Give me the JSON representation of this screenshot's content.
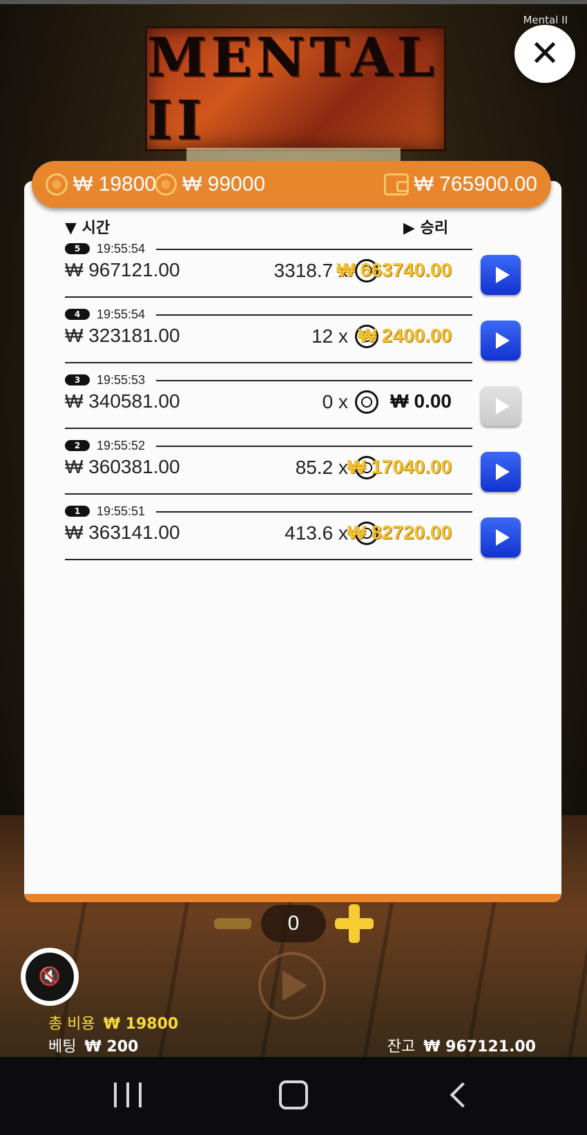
{
  "game_label": "Mental II",
  "logo_text": "MENTAL II",
  "header": {
    "coin_value_1": "₩ 19800",
    "coin_value_2": "₩ 99000",
    "wallet_value": "₩ 765900.00"
  },
  "columns": {
    "time_label": "▼ 시간",
    "win_label": "▶ 승리"
  },
  "rows": [
    {
      "badge": "5",
      "time": "19:55:54",
      "balance": "₩ 967121.00",
      "multiplier": "3318.7 x",
      "win": "₩ 663740.00",
      "replay_enabled": true
    },
    {
      "badge": "4",
      "time": "19:55:54",
      "balance": "₩ 323181.00",
      "multiplier": "12 x",
      "win": "₩ 2400.00",
      "replay_enabled": true
    },
    {
      "badge": "3",
      "time": "19:55:53",
      "balance": "₩ 340581.00",
      "multiplier": "0 x",
      "win": "₩ 0.00",
      "replay_enabled": false
    },
    {
      "badge": "2",
      "time": "19:55:52",
      "balance": "₩ 360381.00",
      "multiplier": "85.2 x",
      "win": "₩ 17040.00",
      "replay_enabled": true
    },
    {
      "badge": "1",
      "time": "19:55:51",
      "balance": "₩ 363141.00",
      "multiplier": "413.6 x",
      "win": "₩ 82720.00",
      "replay_enabled": true
    }
  ],
  "stepper": {
    "value": "0"
  },
  "footer": {
    "total_cost_label": "총 비용",
    "total_cost_value": "₩ 19800",
    "bet_label": "베팅",
    "bet_value": "₩ 200",
    "balance_label": "잔고",
    "balance_value": "₩ 967121.00"
  },
  "icons": {
    "close": "close-icon",
    "mute": "speaker-muted-icon",
    "coin": "coin-icon",
    "wallet": "wallet-icon",
    "play": "play-icon"
  },
  "colors": {
    "accent_orange": "#e8862e",
    "win_gold": "#f2c230",
    "play_blue": "#1a3fe0"
  }
}
